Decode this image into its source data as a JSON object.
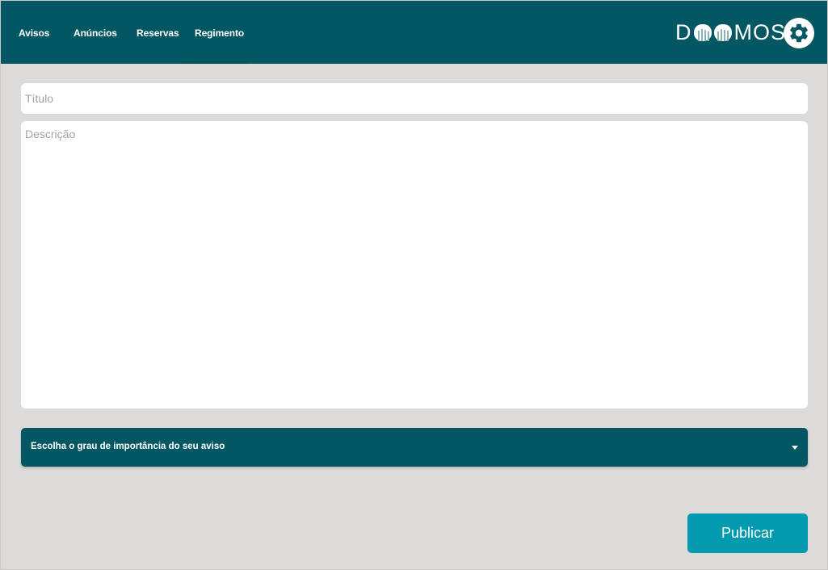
{
  "nav": {
    "items": [
      {
        "label": "Avisos"
      },
      {
        "label": "Anúncios"
      },
      {
        "label": "Reservas"
      },
      {
        "label": "Regimento"
      }
    ]
  },
  "brand": {
    "logo_text_start": "D",
    "logo_text_end": "MOS",
    "settings_icon": "gear-icon"
  },
  "form": {
    "title_placeholder": "Título",
    "title_value": "",
    "description_placeholder": "Descrição",
    "description_value": "",
    "importance_select_label": "Escolha o grau de importância do seu aviso",
    "publish_label": "Publicar"
  },
  "colors": {
    "header_bg": "#025763",
    "page_bg": "#dcdbda",
    "select_bg": "#025763",
    "publish_bg": "#039ab0"
  }
}
